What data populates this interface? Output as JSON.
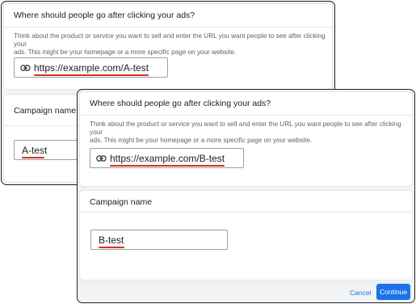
{
  "back_window": {
    "url_card": {
      "title": "Where should people go after clicking your ads?",
      "description": "Think about the product or service you want to sell and enter the URL you want people to see after clicking your\nads. This might be your homepage or a more specific page on your website.",
      "url_value": "https://example.com/A-test",
      "icon": "link-icon"
    },
    "campaign_card": {
      "title": "Campaign name",
      "value": "A-test"
    }
  },
  "front_window": {
    "url_card": {
      "title": "Where should people go after clicking your ads?",
      "description": "Think about the product or service you want to sell and enter the URL you want people to see after clicking your\nads. This might be your homepage or a more specific page on your website.",
      "url_value": "https://example.com/B-test",
      "icon": "link-icon"
    },
    "campaign_card": {
      "title": "Campaign name",
      "value": "B-test"
    },
    "footer": {
      "cancel_label": "Cancel",
      "continue_label": "Continue"
    }
  },
  "colors": {
    "primary": "#1a73e8",
    "spellcheck": "#d93025",
    "background": "#f1f3f4",
    "border": "#202124"
  }
}
